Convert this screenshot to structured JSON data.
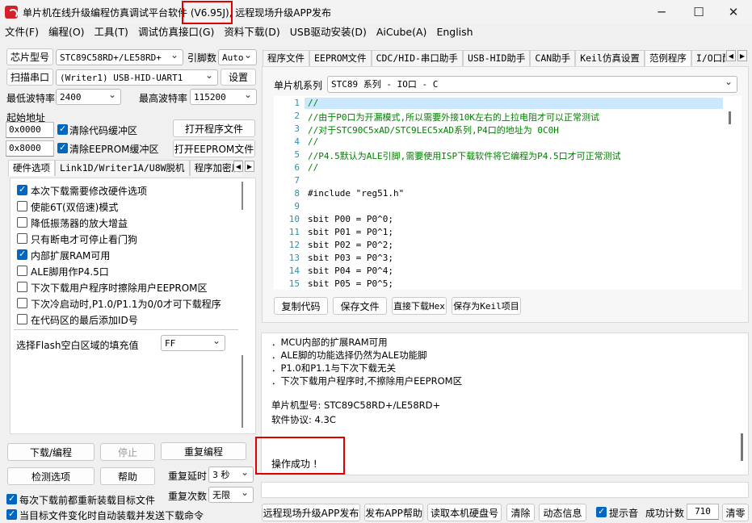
{
  "window": {
    "title_part1": "单片机在线升级编程仿真调试平台软件 ",
    "title_version": "(V6.95J)",
    "title_part2": ", 远程现场升级APP发布",
    "min": "─",
    "max": "☐",
    "close": "✕"
  },
  "menu": [
    "文件(F)",
    "编程(O)",
    "工具(T)",
    "调试仿真接口(G)",
    "资料下载(D)",
    "USB驱动安装(D)",
    "AiCube(A)",
    "English"
  ],
  "left": {
    "chip_btn": "芯片型号",
    "chip_value": "STC89C58RD+/LE58RD+",
    "pins_label": "引脚数",
    "pins_value": "Auto",
    "scan_btn": "扫描串口",
    "port_value": "(Writer1) USB-HID-UART1",
    "settings_btn": "设置",
    "min_baud_label": "最低波特率",
    "min_baud": "2400",
    "max_baud_label": "最高波特率",
    "max_baud": "115200",
    "start_addr_label": "起始地址",
    "addr1": "0x0000",
    "clear_code": "清除代码缓冲区",
    "open_prog": "打开程序文件",
    "addr2": "0x8000",
    "clear_eeprom": "清除EEPROM缓冲区",
    "open_eeprom": "打开EEPROM文件",
    "tabs": [
      "硬件选项",
      "Link1D/Writer1A/U8W脱机",
      "程序加密后"
    ],
    "options": [
      {
        "label": "本次下载需要修改硬件选项",
        "checked": true
      },
      {
        "label": "使能6T(双倍速)模式",
        "checked": false
      },
      {
        "label": "降低振荡器的放大增益",
        "checked": false
      },
      {
        "label": "只有断电才可停止看门狗",
        "checked": false
      },
      {
        "label": "内部扩展RAM可用",
        "checked": true
      },
      {
        "label": "ALE脚用作P4.5口",
        "checked": false
      },
      {
        "label": "下次下载用户程序时擦除用户EEPROM区",
        "checked": false
      },
      {
        "label": "下次冷启动时,P1.0/P1.1为0/0才可下载程序",
        "checked": false
      },
      {
        "label": "在代码区的最后添加ID号",
        "checked": false
      }
    ],
    "fill_label": "选择Flash空白区域的填充值",
    "fill_value": "FF",
    "download_btn": "下载/编程",
    "stop_btn": "停止",
    "reprogram_btn": "重复编程",
    "check_btn": "检测选项",
    "help_btn": "帮助",
    "repeat_delay_label": "重复延时",
    "repeat_delay": "3 秒",
    "repeat_count_label": "重复次数",
    "repeat_count": "无限",
    "reload_label": "每次下载前都重新装载目标文件",
    "auto_label": "当目标文件变化时自动装载并发送下载命令"
  },
  "right": {
    "tabs": [
      "程序文件",
      "EEPROM文件",
      "CDC/HID-串口助手",
      "USB-HID助手",
      "CAN助手",
      "Keil仿真设置",
      "范例程序",
      "I/O口配置"
    ],
    "series_label": "单片机系列",
    "series_value": "STC89 系列 - IO口 - C",
    "code_lines": [
      {
        "n": "1",
        "t": "//",
        "c": true
      },
      {
        "n": "2",
        "t": "//由于P0口为开漏模式,所以需要外接10K左右的上拉电阻才可以正常测试",
        "c": true
      },
      {
        "n": "3",
        "t": "//对于STC90C5xAD/STC9LEC5xAD系列,P4口的地址为 0C0H",
        "c": true
      },
      {
        "n": "4",
        "t": "//",
        "c": true
      },
      {
        "n": "5",
        "t": "//P4.5默认为ALE引脚,需要使用ISP下载软件将它编程为P4.5口才可正常测试",
        "c": true
      },
      {
        "n": "6",
        "t": "//",
        "c": true
      },
      {
        "n": "7",
        "t": "",
        "c": false
      },
      {
        "n": "8",
        "t": "#include \"reg51.h\"",
        "c": false
      },
      {
        "n": "9",
        "t": "",
        "c": false
      },
      {
        "n": "10",
        "t": "sbit P00 = P0^0;",
        "c": false
      },
      {
        "n": "11",
        "t": "sbit P01 = P0^1;",
        "c": false
      },
      {
        "n": "12",
        "t": "sbit P02 = P0^2;",
        "c": false
      },
      {
        "n": "13",
        "t": "sbit P03 = P0^3;",
        "c": false
      },
      {
        "n": "14",
        "t": "sbit P04 = P0^4;",
        "c": false
      },
      {
        "n": "15",
        "t": "sbit P05 = P0^5;",
        "c": false
      }
    ],
    "copy_btn": "复制代码",
    "save_btn": "保存文件",
    "download_hex_btn": "直接下载Hex",
    "save_keil_btn": "保存为Keil项目",
    "log": [
      "．MCU内部的扩展RAM可用",
      "．ALE脚的功能选择仍然为ALE功能脚",
      "．P1.0和P1.1与下次下载无关",
      "．下次下载用户程序时,不擦除用户EEPROM区",
      "",
      "单片机型号: STC89C58RD+/LE58RD+",
      "软件协议: 4.3C"
    ],
    "success": "操作成功 !",
    "bottom": {
      "remote_btn": "远程现场升级APP发布",
      "help_btn": "发布APP帮助",
      "read_btn": "读取本机硬盘号",
      "clear_btn": "清除",
      "dynamic_btn": "动态信息",
      "beep_label": "提示音",
      "count_label": "成功计数",
      "count_value": "710",
      "clear_count_btn": "清零"
    }
  }
}
